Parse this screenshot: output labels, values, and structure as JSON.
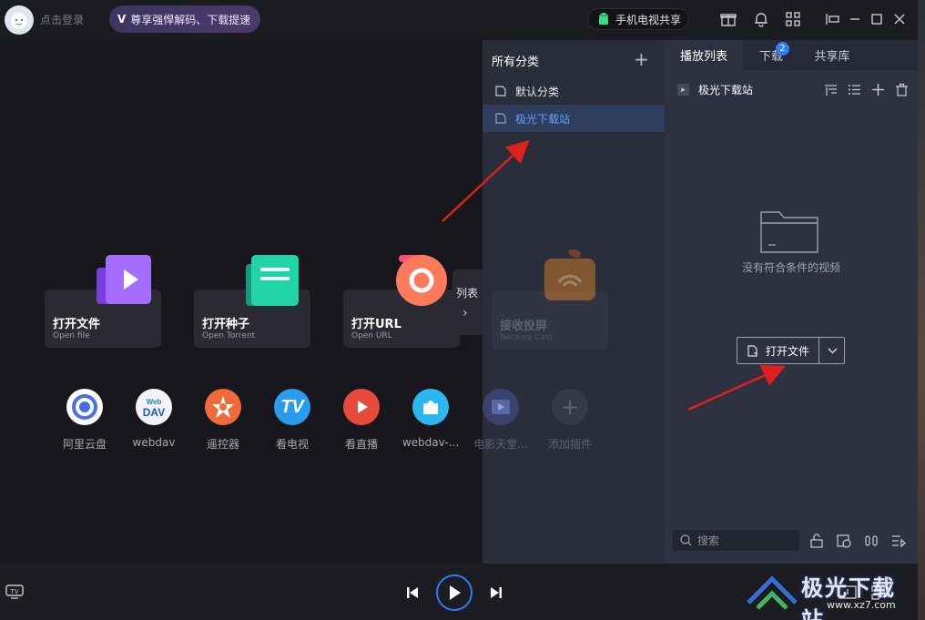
{
  "topbar": {
    "login_label": "点击登录",
    "vip_label": "尊享强悍解码、下载提速",
    "vip_mark": "V",
    "share_tv_label": "手机电视共享",
    "icons": [
      "gift-icon",
      "bell-icon",
      "grid-icon",
      "pin-icon",
      "minimize-icon",
      "maximize-icon",
      "close-icon"
    ]
  },
  "main": {
    "cards": [
      {
        "title": "打开文件",
        "subtitle": "Open file",
        "icon": "video-file-icon",
        "color": "#8b4cf0"
      },
      {
        "title": "打开种子",
        "subtitle": "Open Torrent",
        "icon": "torrent-icon",
        "color": "#20c4a0"
      },
      {
        "title": "打开URL",
        "subtitle": "Open URL",
        "icon": "url-icon",
        "color": "#ff6a6a"
      }
    ],
    "faded_card": {
      "title": "接收投屏",
      "subtitle": "Receive Cast"
    },
    "plugins": [
      {
        "label": "阿里云盘",
        "icon": "aliyun-drive-icon",
        "color": "#4a6cf0"
      },
      {
        "label": "webdav",
        "icon": "webdav-icon",
        "color": "#f0f0f0"
      },
      {
        "label": "遥控器",
        "icon": "remote-icon",
        "color": "#f06a3a"
      },
      {
        "label": "看电视",
        "icon": "tv-icon",
        "color": "#2a9cf0"
      },
      {
        "label": "看直播",
        "icon": "live-icon",
        "color": "#e84a3a"
      },
      {
        "label": "webdav-...",
        "icon": "webdav-plugin-icon",
        "color": "#2ab8f0"
      }
    ],
    "faded_plugins": [
      {
        "label": "电影天堂...",
        "icon": "movie-icon"
      },
      {
        "label": "添加插件",
        "icon": "add-plugin-icon"
      }
    ],
    "list_toggle_label": "列表"
  },
  "categories": {
    "header": "所有分类",
    "items": [
      {
        "label": "默认分类",
        "active": false
      },
      {
        "label": "极光下载站",
        "active": true
      }
    ]
  },
  "playlist": {
    "tabs": [
      {
        "label": "播放列表",
        "active": true
      },
      {
        "label": "下载",
        "active": false,
        "badge": "2"
      },
      {
        "label": "共享库",
        "active": false
      }
    ],
    "current_group": "极光下载站",
    "empty_text": "没有符合条件的视频",
    "open_file_label": "打开文件",
    "search_placeholder": "搜索"
  },
  "watermark": {
    "brand": "极光下载站",
    "url": "www.xz7.com"
  },
  "colors": {
    "accent": "#2f7cf6",
    "active_category": "#5fa0ff",
    "annotation_arrow": "#e0201c"
  }
}
